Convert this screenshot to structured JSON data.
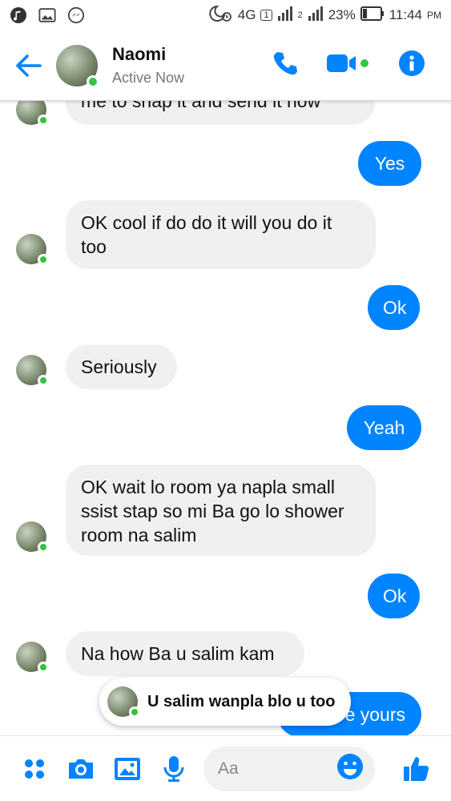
{
  "status_bar": {
    "network": "4G",
    "sim1": "1",
    "sim2": "2",
    "battery": "23%",
    "time": "11:44",
    "ampm": "PM"
  },
  "header": {
    "name": "Naomi",
    "status": "Active Now",
    "accent": "#0084ff"
  },
  "messages": [
    {
      "from": "them",
      "text": "me to snap it and send it now"
    },
    {
      "from": "me",
      "text": "Yes"
    },
    {
      "from": "them",
      "text": "OK cool if do do it will you do it too"
    },
    {
      "from": "me",
      "text": "Ok"
    },
    {
      "from": "them",
      "text": "Seriously"
    },
    {
      "from": "me",
      "text": "Yeah"
    },
    {
      "from": "them",
      "text": "OK wait lo room ya napla small ssist stap so mi Ba go lo shower room na salim"
    },
    {
      "from": "me",
      "text": "Ok"
    },
    {
      "from": "them",
      "text": "Na how Ba u salim kam"
    },
    {
      "from": "me",
      "text": "e yours"
    }
  ],
  "toast": {
    "text": "U salim wanpla blo u too"
  },
  "composer": {
    "placeholder": "Aa"
  }
}
